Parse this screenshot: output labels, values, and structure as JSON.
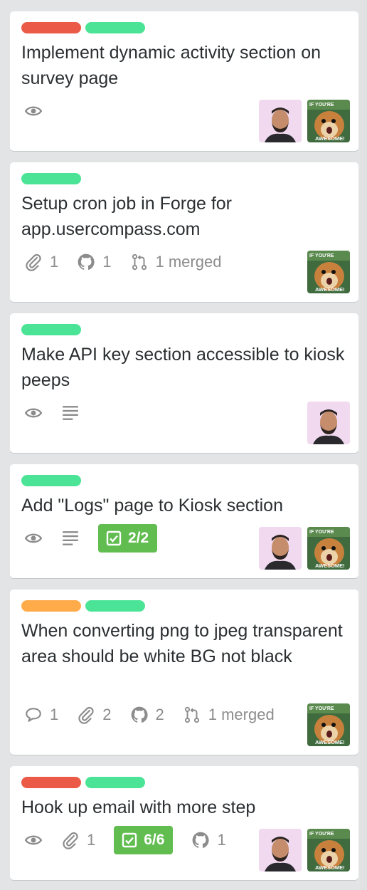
{
  "colors": {
    "red": "#eb5a46",
    "green": "#4be497",
    "orange": "#ffab4a",
    "checklist_complete": "#61bd4f",
    "badge_gray": "#8c8c8c"
  },
  "cards": [
    {
      "labels": [
        "red",
        "green"
      ],
      "title": "Implement dynamic activity section on survey page",
      "badges": {
        "watch": true
      },
      "members": [
        "man-avatar",
        "hamster-avatar"
      ]
    },
    {
      "labels": [
        "green"
      ],
      "title": "Setup cron job in Forge for app.usercompass.com",
      "badges": {
        "attachments": "1",
        "github": "1",
        "pull_requests": "1 merged"
      },
      "members": [
        "hamster-avatar"
      ]
    },
    {
      "labels": [
        "green"
      ],
      "title": "Make API key section accessible to kiosk peeps",
      "badges": {
        "watch": true,
        "description": true
      },
      "members": [
        "man-avatar"
      ]
    },
    {
      "labels": [
        "green"
      ],
      "title": "Add \"Logs\" page to Kiosk section",
      "badges": {
        "watch": true,
        "description": true,
        "checklist": "2/2"
      },
      "members": [
        "man-avatar",
        "hamster-avatar"
      ]
    },
    {
      "labels": [
        "orange",
        "green"
      ],
      "title": "When converting png to jpeg transparent area should be white BG not black",
      "badges": {
        "comments": "1",
        "attachments": "2",
        "github": "2",
        "pull_requests": "1 merged"
      },
      "members": [
        "hamster-avatar"
      ]
    },
    {
      "labels": [
        "red",
        "green"
      ],
      "title": "Hook up email with more step",
      "badges": {
        "watch": true,
        "attachments": "1",
        "checklist": "6/6",
        "github": "1"
      },
      "members": [
        "man-avatar",
        "hamster-avatar"
      ]
    }
  ],
  "avatar_text": {
    "top": "IF YOU'RE",
    "bottom": "AWESOME!"
  }
}
